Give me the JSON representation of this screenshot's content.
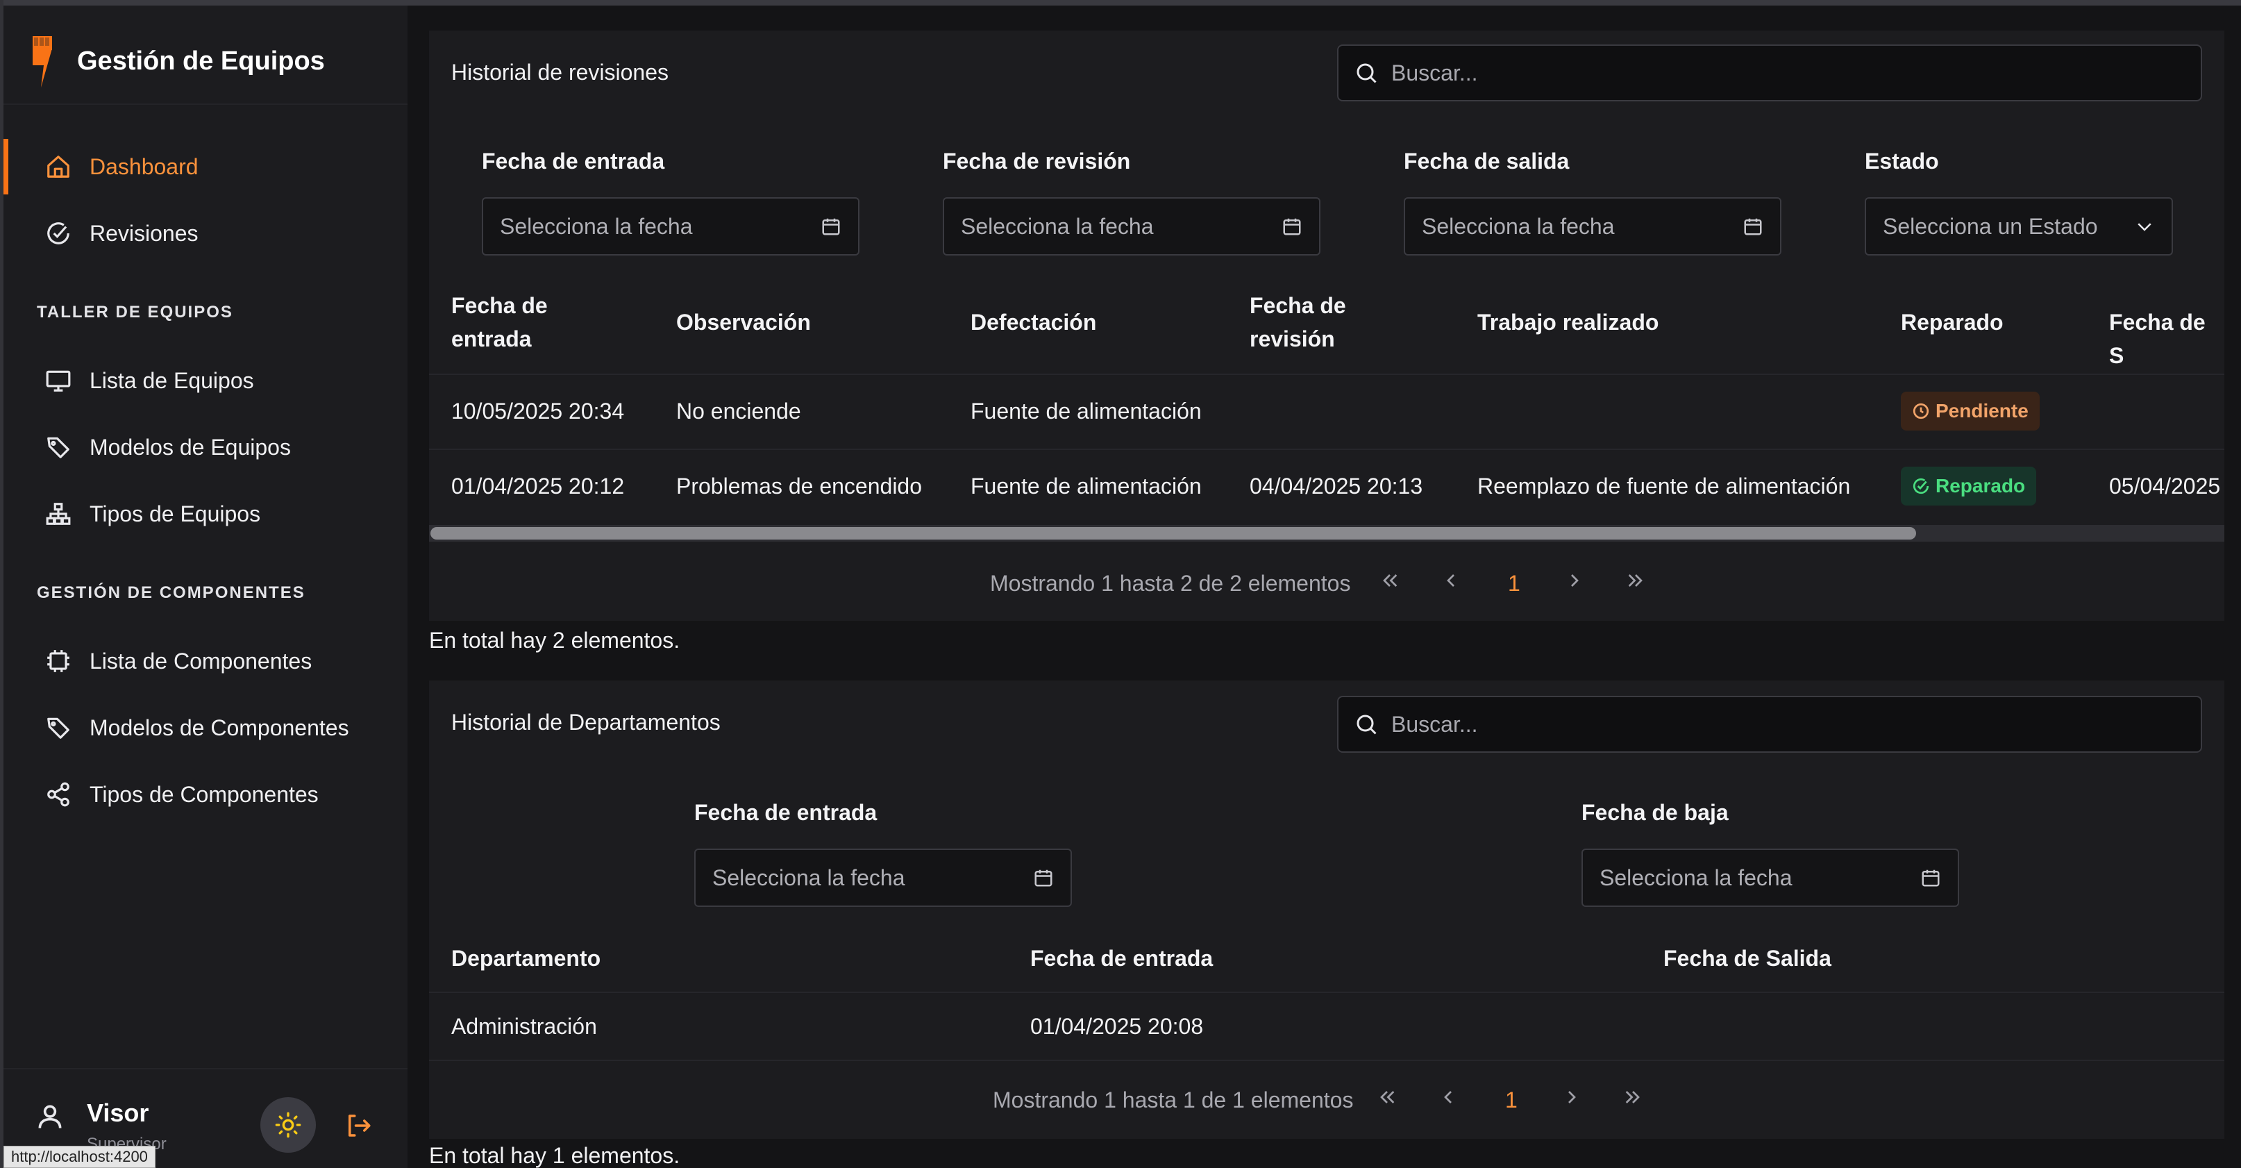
{
  "app": {
    "title": "Gestión de Equipos"
  },
  "sidebar": {
    "dashboard": "Dashboard",
    "revisiones": "Revisiones",
    "section_taller": "TALLER DE EQUIPOS",
    "lista_equipos": "Lista de Equipos",
    "modelos_equipos": "Modelos de Equipos",
    "tipos_equipos": "Tipos de Equipos",
    "section_componentes": "GESTIÓN DE COMPONENTES",
    "lista_componentes": "Lista de Componentes",
    "modelos_componentes": "Modelos de Componentes",
    "tipos_componentes": "Tipos de Componentes"
  },
  "user": {
    "name": "Visor",
    "role": "Supervisor"
  },
  "status_url": "http://localhost:4200",
  "revisiones": {
    "title": "Historial de revisiones",
    "search_placeholder": "Buscar...",
    "filters": {
      "entrada_label": "Fecha de entrada",
      "revision_label": "Fecha de revisión",
      "salida_label": "Fecha de salida",
      "estado_label": "Estado",
      "date_placeholder": "Selecciona la fecha",
      "estado_placeholder": "Selecciona un Estado"
    },
    "columns": {
      "entrada_l1": "Fecha de",
      "entrada_l2": "entrada",
      "observacion": "Observación",
      "defectacion": "Defectación",
      "revision_l1": "Fecha de",
      "revision_l2": "revisión",
      "trabajo": "Trabajo realizado",
      "reparado": "Reparado",
      "salida": "Fecha de S"
    },
    "rows": [
      {
        "entrada": "10/05/2025 20:34",
        "observacion": "No enciende",
        "defectacion": "Fuente de alimentación",
        "revision": "",
        "trabajo": "",
        "estado": "Pendiente",
        "salida": ""
      },
      {
        "entrada": "01/04/2025 20:12",
        "observacion": "Problemas de encendido",
        "defectacion": "Fuente de alimentación",
        "revision": "04/04/2025 20:13",
        "trabajo": "Reemplazo de fuente de alimentación",
        "estado": "Reparado",
        "salida": "05/04/2025"
      }
    ],
    "pager_text": "Mostrando 1 hasta 2 de 2 elementos",
    "current_page": "1",
    "total_text": "En total hay 2 elementos."
  },
  "departamentos": {
    "title": "Historial de Departamentos",
    "search_placeholder": "Buscar...",
    "filters": {
      "entrada_label": "Fecha de entrada",
      "baja_label": "Fecha de baja",
      "date_placeholder": "Selecciona la fecha"
    },
    "columns": {
      "departamento": "Departamento",
      "entrada": "Fecha de entrada",
      "salida": "Fecha de Salida"
    },
    "rows": [
      {
        "departamento": "Administración",
        "entrada": "01/04/2025 20:08",
        "salida": ""
      }
    ],
    "pager_text": "Mostrando 1 hasta 1 de 1 elementos",
    "current_page": "1",
    "total_text": "En total hay 1 elementos."
  },
  "colors": {
    "accent": "#f97316",
    "pending": "#f2a46a",
    "repaired": "#4ade80"
  }
}
